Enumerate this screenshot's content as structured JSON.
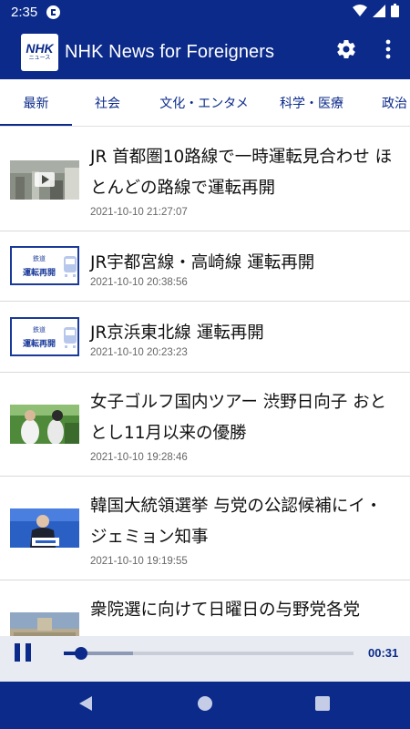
{
  "status_bar": {
    "time": "2:35"
  },
  "app_bar": {
    "logo_text": "NHK",
    "logo_subtext": "ニュース",
    "title": "NHK News for Foreigners"
  },
  "tabs": [
    {
      "label": "最新",
      "active": true
    },
    {
      "label": "社会",
      "active": false
    },
    {
      "label": "文化・エンタメ",
      "active": false
    },
    {
      "label": "科学・医療",
      "active": false
    },
    {
      "label": "政治",
      "active": false
    }
  ],
  "news": [
    {
      "title": "JR 首都圏10路線で一時運転見合わせ ほとんどの路線で運転再開",
      "date": "2021-10-10 21:27:07",
      "thumb": "video"
    },
    {
      "title": "JR宇都宮線・高崎線 運転再開",
      "date": "2021-10-10 20:38:56",
      "thumb": "rail"
    },
    {
      "title": "JR京浜東北線 運転再開",
      "date": "2021-10-10 20:23:23",
      "thumb": "rail"
    },
    {
      "title": "女子ゴルフ国内ツアー 渋野日向子 おととし11月以来の優勝",
      "date": "2021-10-10 19:28:46",
      "thumb": "golf"
    },
    {
      "title": "韓国大統領選挙 与党の公認候補にイ・ジェミョン知事",
      "date": "2021-10-10 19:19:55",
      "thumb": "politics"
    },
    {
      "title": "衆院選に向けて日曜日の与野党各党",
      "date": "",
      "thumb": "building"
    }
  ],
  "rail_thumb": {
    "line1": "鉄道",
    "line2": "運転再開"
  },
  "player": {
    "elapsed_time": "00:31",
    "progress": 0.06,
    "buffered": 0.24
  },
  "colors": {
    "primary": "#0b2a8a",
    "background": "#ffffff",
    "divider": "#d9d9d9"
  },
  "icons": [
    "gear-icon",
    "more-vert-icon",
    "pause-icon",
    "back-icon",
    "home-icon",
    "recents-icon",
    "wifi-icon",
    "signal-icon",
    "battery-icon"
  ]
}
